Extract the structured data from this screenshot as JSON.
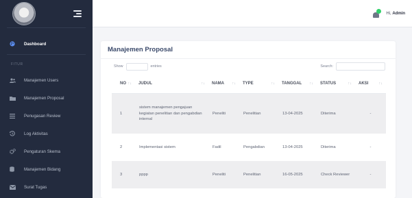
{
  "sidebar": {
    "items": [
      {
        "label": "Dashboard",
        "icon": "palette-icon",
        "active": true
      },
      {
        "label": "Manajemen Users",
        "icon": "users-icon"
      },
      {
        "label": "Manajemen Proposal",
        "icon": "folder-icon"
      },
      {
        "label": "Penugasan Review",
        "icon": "list-icon"
      },
      {
        "label": "Log Aktivitas",
        "icon": "history-icon"
      },
      {
        "label": "Pengaturan Skema",
        "icon": "cogs-icon"
      },
      {
        "label": "Manajemen Bidang",
        "icon": "database-icon"
      },
      {
        "label": "Surat Tugas",
        "icon": "envelope-icon"
      }
    ],
    "section_label": "FITUR"
  },
  "topbar": {
    "greeting": "Hi,",
    "username": "Admin"
  },
  "card": {
    "title": "Manajemen Proposal",
    "show_label": "Show",
    "entries_label": "entries",
    "search_label": "Search:"
  },
  "table": {
    "headers": {
      "no": "NO",
      "judul": "JUDUL",
      "nama": "NAMA",
      "type": "TYPE",
      "tanggal": "TANGGAL",
      "status": "STATUS",
      "aksi": "AKSI"
    },
    "sort_glyph": "↑↓",
    "rows": [
      {
        "no": "1",
        "judul": "sistem manajemen pengajuan kegiatan penelitian dan pengabdian internal",
        "nama": "Peneliti",
        "type": "Penelitian",
        "tanggal": "13-04-2025",
        "status": "Diterima",
        "aksi": "-"
      },
      {
        "no": "2",
        "judul": "Implementasi sistem",
        "nama": "Fadil",
        "type": "Pengabdian",
        "tanggal": "13-04-2025",
        "status": "Diterima",
        "aksi": "-"
      },
      {
        "no": "3",
        "judul": "pppp",
        "nama": "Peneliti",
        "type": "Penelitian",
        "tanggal": "16-05-2025",
        "status": "Check Reviewer",
        "aksi": "-"
      }
    ]
  },
  "colors": {
    "sidebar_bg": "#232b3e",
    "accent": "#5b8dee",
    "notification": "#2fd16a",
    "title": "#3b4a6b"
  }
}
